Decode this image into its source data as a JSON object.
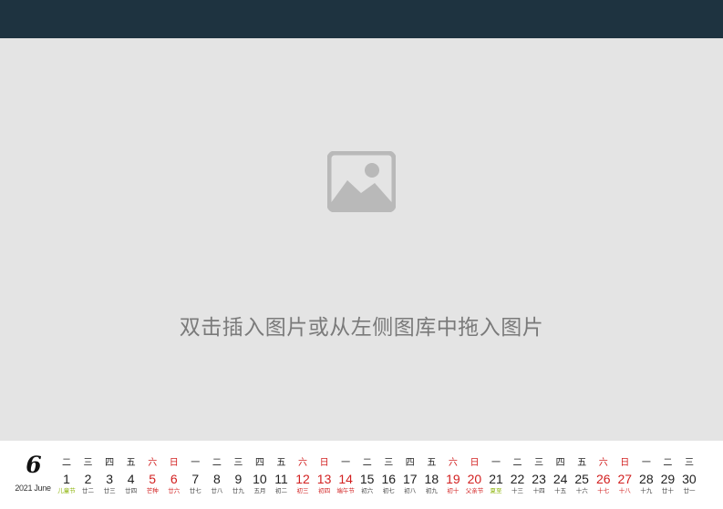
{
  "placeholder": {
    "text": "双击插入图片或从左侧图库中拖入图片",
    "icon": "image-placeholder-icon"
  },
  "calendar": {
    "month_number": "6",
    "year_month": "2021 June",
    "colors": {
      "weekend": "#d21f1f",
      "festival": "#8db40b",
      "normal": "#222222"
    },
    "weekdays": [
      "二",
      "三",
      "四",
      "五",
      "六",
      "日",
      "一",
      "二",
      "三",
      "四",
      "五",
      "六",
      "日",
      "一",
      "二",
      "三",
      "四",
      "五",
      "六",
      "日",
      "一",
      "二",
      "三",
      "四",
      "五",
      "六",
      "日",
      "一",
      "二",
      "三"
    ],
    "days": [
      {
        "num": "1",
        "lunar": "儿童节",
        "type": "festival-green"
      },
      {
        "num": "2",
        "lunar": "廿二",
        "type": "normal"
      },
      {
        "num": "3",
        "lunar": "廿三",
        "type": "normal"
      },
      {
        "num": "4",
        "lunar": "廿四",
        "type": "normal"
      },
      {
        "num": "5",
        "lunar": "芒种",
        "type": "weekend"
      },
      {
        "num": "6",
        "lunar": "廿六",
        "type": "weekend"
      },
      {
        "num": "7",
        "lunar": "廿七",
        "type": "normal"
      },
      {
        "num": "8",
        "lunar": "廿八",
        "type": "normal"
      },
      {
        "num": "9",
        "lunar": "廿九",
        "type": "normal"
      },
      {
        "num": "10",
        "lunar": "五月",
        "type": "normal"
      },
      {
        "num": "11",
        "lunar": "初二",
        "type": "normal"
      },
      {
        "num": "12",
        "lunar": "初三",
        "type": "weekend"
      },
      {
        "num": "13",
        "lunar": "初四",
        "type": "weekend"
      },
      {
        "num": "14",
        "lunar": "端午节",
        "type": "festival-red"
      },
      {
        "num": "15",
        "lunar": "初六",
        "type": "normal"
      },
      {
        "num": "16",
        "lunar": "初七",
        "type": "normal"
      },
      {
        "num": "17",
        "lunar": "初八",
        "type": "normal"
      },
      {
        "num": "18",
        "lunar": "初九",
        "type": "normal"
      },
      {
        "num": "19",
        "lunar": "初十",
        "type": "weekend"
      },
      {
        "num": "20",
        "lunar": "父亲节",
        "type": "weekend"
      },
      {
        "num": "21",
        "lunar": "夏至",
        "type": "festival-green"
      },
      {
        "num": "22",
        "lunar": "十三",
        "type": "normal"
      },
      {
        "num": "23",
        "lunar": "十四",
        "type": "normal"
      },
      {
        "num": "24",
        "lunar": "十五",
        "type": "normal"
      },
      {
        "num": "25",
        "lunar": "十六",
        "type": "normal"
      },
      {
        "num": "26",
        "lunar": "十七",
        "type": "weekend"
      },
      {
        "num": "27",
        "lunar": "十八",
        "type": "weekend"
      },
      {
        "num": "28",
        "lunar": "十九",
        "type": "normal"
      },
      {
        "num": "29",
        "lunar": "廿十",
        "type": "normal"
      },
      {
        "num": "30",
        "lunar": "廿一",
        "type": "normal"
      }
    ]
  }
}
